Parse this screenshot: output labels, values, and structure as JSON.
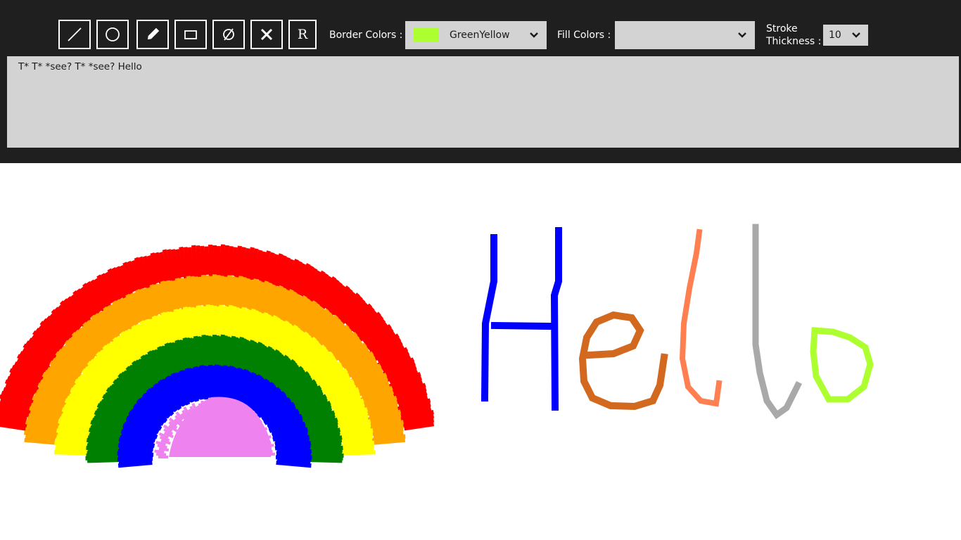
{
  "tools": [
    {
      "name": "line-tool",
      "icon": "line-icon"
    },
    {
      "name": "ellipse-tool",
      "icon": "circle-icon"
    },
    {
      "name": "pen-tool",
      "icon": "pencil-icon"
    },
    {
      "name": "rectangle-tool",
      "icon": "rectangle-icon"
    },
    {
      "name": "erase-tool",
      "icon": "empty-set-icon"
    },
    {
      "name": "clear-tool",
      "icon": "close-icon"
    },
    {
      "name": "reset-tool",
      "icon": "letter-r-icon",
      "label": "R"
    }
  ],
  "border": {
    "label": "Border Colors :",
    "selected": "GreenYellow",
    "swatch_color": "#adff2f"
  },
  "fill": {
    "label": "Fill Colors :",
    "selected": ""
  },
  "stroke": {
    "label_line1": "Stroke",
    "label_line2": "Thickness :",
    "selected": "10"
  },
  "text_input": {
    "value": "T* T* *see? T* *see? Hello"
  },
  "colors": {
    "toolbar_bg": "#1f1f1f",
    "panel_bg": "#d3d3d3",
    "canvas_bg": "#ffffff",
    "rainbow": [
      "#ff0000",
      "#ffa500",
      "#ffff00",
      "#008000",
      "#0000ff",
      "#ee82ee"
    ],
    "hello_letters": [
      "#0000ff",
      "#d2691e",
      "#ff7f50",
      "#a9a9a9",
      "#adff2f"
    ]
  },
  "canvas": {
    "drawing": "rainbow",
    "handwriting": "Hello"
  }
}
